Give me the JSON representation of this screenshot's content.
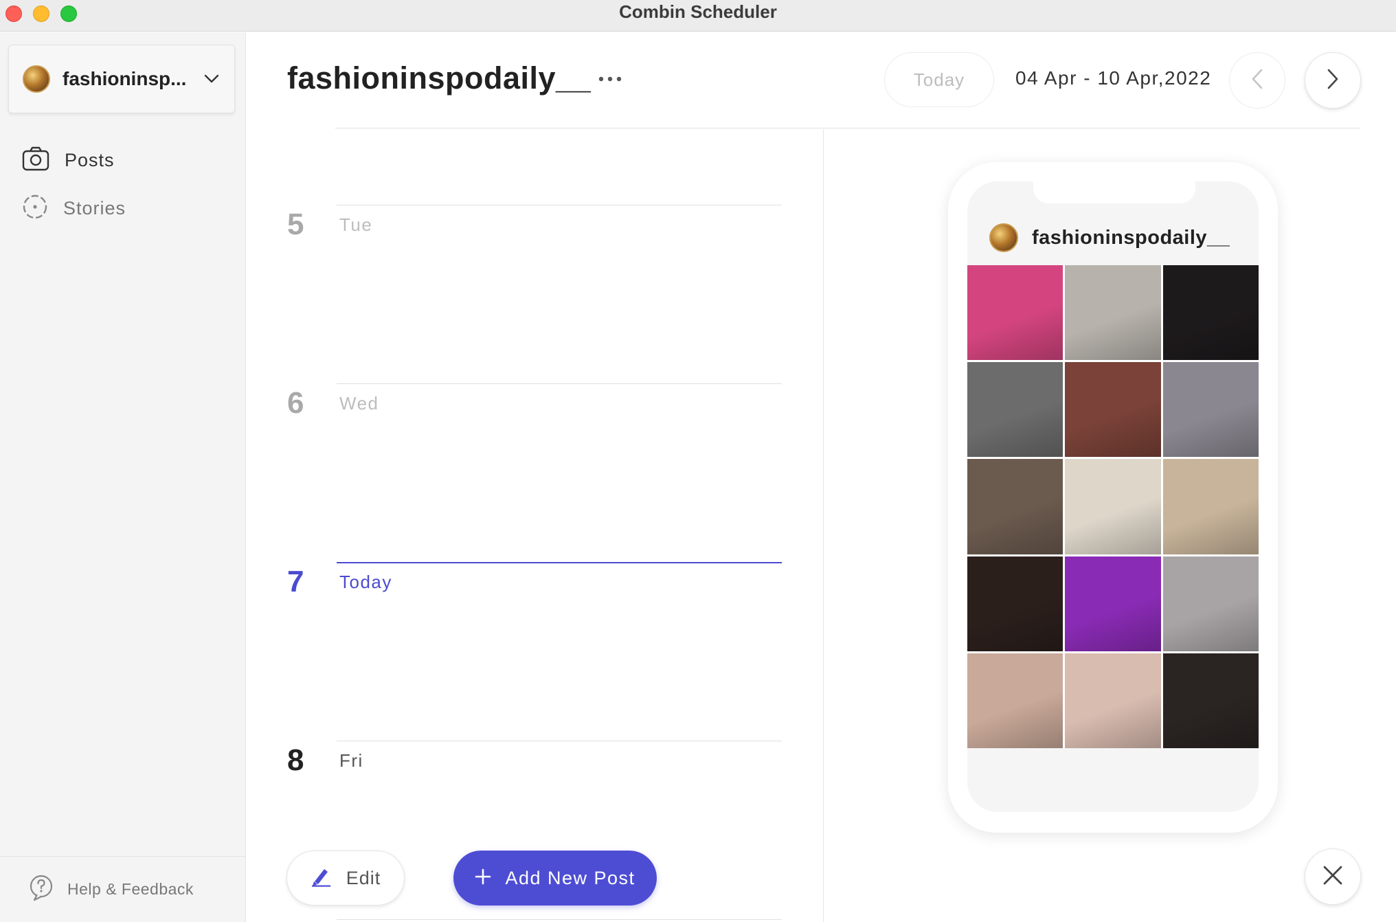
{
  "window": {
    "title": "Combin Scheduler"
  },
  "sidebar": {
    "account": {
      "name": "fashioninsp...",
      "icon": "chevron-down-icon"
    },
    "nav": [
      {
        "label": "Posts",
        "icon": "camera-icon"
      },
      {
        "label": "Stories",
        "icon": "stories-ring-icon"
      }
    ],
    "footer": {
      "label": "Help & Feedback",
      "icon": "help-icon"
    }
  },
  "header": {
    "title": "fashioninspodaily__",
    "today_label": "Today",
    "date_range": "04 Apr - 10 Apr,2022"
  },
  "calendar": {
    "days": [
      {
        "num": "5",
        "name": "Tue",
        "state": "past"
      },
      {
        "num": "6",
        "name": "Wed",
        "state": "past"
      },
      {
        "num": "7",
        "name": "Today",
        "state": "today"
      },
      {
        "num": "8",
        "name": "Fri",
        "state": "future"
      }
    ],
    "edit_label": "Edit",
    "add_label": "Add New Post"
  },
  "preview": {
    "handle": "fashioninspodaily__",
    "tiles": [
      "#d4457f",
      "#b7b2ac",
      "#1d1a1c",
      "#6c6c6c",
      "#7a4238",
      "#8a8790",
      "#6b5a4e",
      "#ddd6c9",
      "#c8b49a",
      "#2b1f1c",
      "#8a2bb5",
      "#a8a4a6",
      "#c9a999",
      "#d9bcb0",
      "#2a2422"
    ]
  },
  "colors": {
    "accent": "#4d4dd4",
    "today": "#4b4bd0"
  }
}
